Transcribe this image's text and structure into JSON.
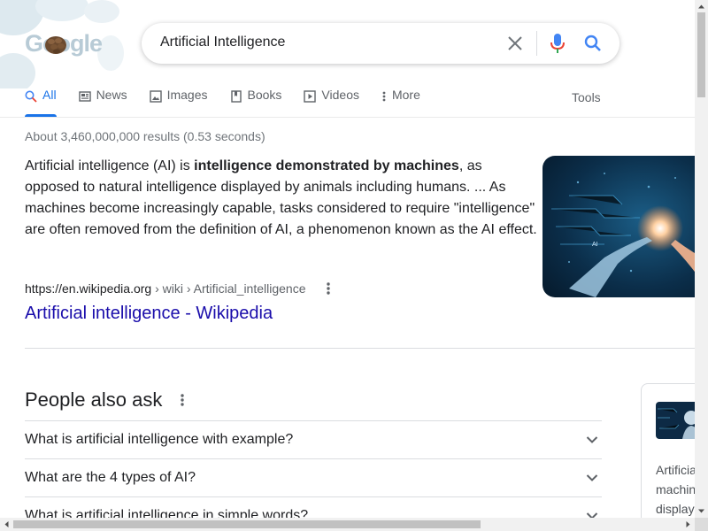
{
  "logo": {
    "text": "Google"
  },
  "search": {
    "query": "Artificial Intelligence"
  },
  "tabs": [
    {
      "label": "All",
      "icon": "search-icon"
    },
    {
      "label": "News",
      "icon": "news-icon"
    },
    {
      "label": "Images",
      "icon": "image-icon"
    },
    {
      "label": "Books",
      "icon": "book-icon"
    },
    {
      "label": "Videos",
      "icon": "video-icon"
    },
    {
      "label": "More",
      "icon": "more-vert-icon"
    }
  ],
  "tools_label": "Tools",
  "result_stats": "About 3,460,000,000 results (0.53 seconds)",
  "snippet": {
    "before": "Artificial intelligence (AI) is ",
    "bold": "intelligence demonstrated by machines",
    "after": ", as opposed to natural intelligence displayed by animals including humans. ... As machines become increasingly capable, tasks considered to require \"intelligence\" are often removed from the definition of AI, a phenomenon known as the AI effect."
  },
  "cite": {
    "domain": "https://en.wikipedia.org",
    "path": " › wiki › Artificial_intelligence"
  },
  "result_title": "Artificial intelligence - Wikipedia",
  "people_also_ask": {
    "title": "People also ask",
    "questions": [
      "What is artificial intelligence with example?",
      "What are the 4 types of AI?",
      "What is artificial intelligence in simple words?"
    ]
  },
  "knowledge_panel": {
    "lines": [
      "Artificia",
      "machin",
      "display"
    ]
  },
  "colors": {
    "link": "#1a0dab",
    "accent": "#1a73e8",
    "text": "#202124",
    "muted": "#70757a"
  }
}
